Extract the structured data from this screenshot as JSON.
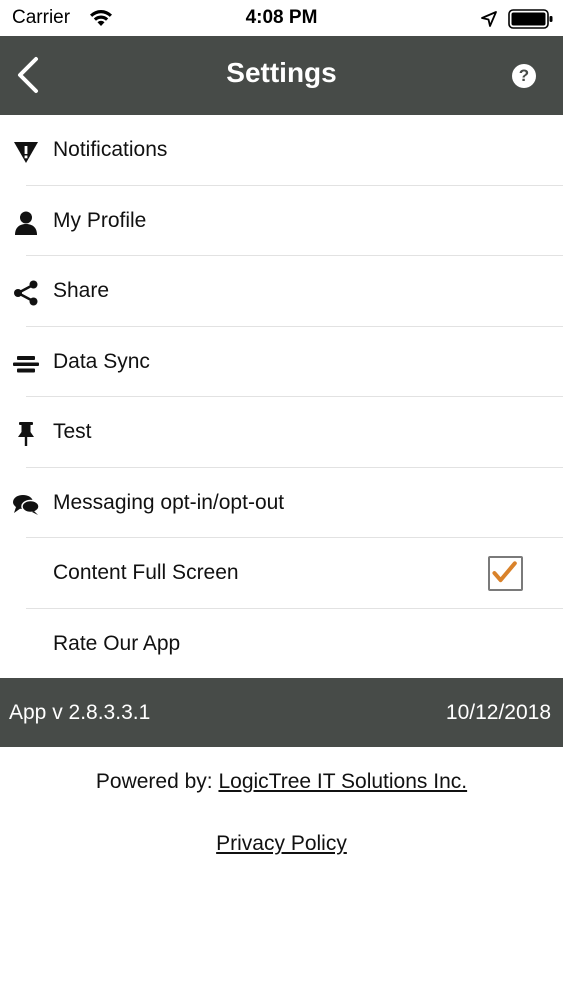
{
  "status_bar": {
    "carrier": "Carrier",
    "time": "4:08 PM",
    "icons": [
      "wifi-icon",
      "location-arrow-icon",
      "battery-icon"
    ]
  },
  "nav": {
    "title": "Settings",
    "back_icon": "chevron-left-icon",
    "help_label": "?"
  },
  "settings": {
    "items": [
      {
        "label": "Notifications",
        "icon": "notification-flag-icon"
      },
      {
        "label": "My Profile",
        "icon": "user-icon"
      },
      {
        "label": "Share",
        "icon": "share-icon"
      },
      {
        "label": "Data Sync",
        "icon": "data-sync-icon"
      },
      {
        "label": "Test",
        "icon": "pin-icon"
      },
      {
        "label": "Messaging opt-in/opt-out",
        "icon": "chat-bubbles-icon"
      },
      {
        "label": "Content Full Screen",
        "icon": "",
        "checked": true
      },
      {
        "label": "Rate Our App",
        "icon": ""
      }
    ]
  },
  "version_bar": {
    "version": "App v 2.8.3.3.1",
    "date": "10/12/2018"
  },
  "footer": {
    "powered_prefix": "Powered by:",
    "company": "LogicTree IT Solutions Inc.",
    "privacy": "Privacy Policy"
  },
  "colors": {
    "bar_background": "#474b48",
    "checkmark": "#d9822b",
    "separator": "#e2e2e2"
  }
}
